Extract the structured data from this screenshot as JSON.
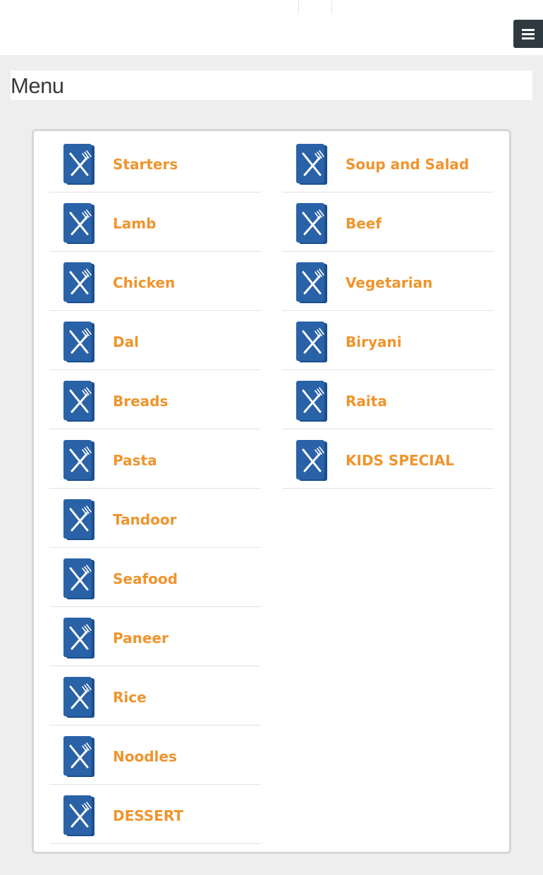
{
  "page_title": "Menu",
  "colors": {
    "accent": "#f0942c",
    "icon": "#1b4f8f",
    "toggle": "#2f3a40"
  },
  "menu_icon": "menu-book-fork-knife-icon",
  "categories_left": [
    {
      "label": "Starters"
    },
    {
      "label": "Lamb"
    },
    {
      "label": "Chicken"
    },
    {
      "label": "Dal"
    },
    {
      "label": "Breads"
    },
    {
      "label": "Pasta"
    },
    {
      "label": "Tandoor"
    },
    {
      "label": "Seafood"
    },
    {
      "label": "Paneer"
    },
    {
      "label": "Rice"
    },
    {
      "label": "Noodles"
    },
    {
      "label": "DESSERT"
    }
  ],
  "categories_right": [
    {
      "label": "Soup and Salad"
    },
    {
      "label": "Beef"
    },
    {
      "label": "Vegetarian"
    },
    {
      "label": "Biryani"
    },
    {
      "label": "Raita"
    },
    {
      "label": "KIDS SPECIAL"
    }
  ]
}
